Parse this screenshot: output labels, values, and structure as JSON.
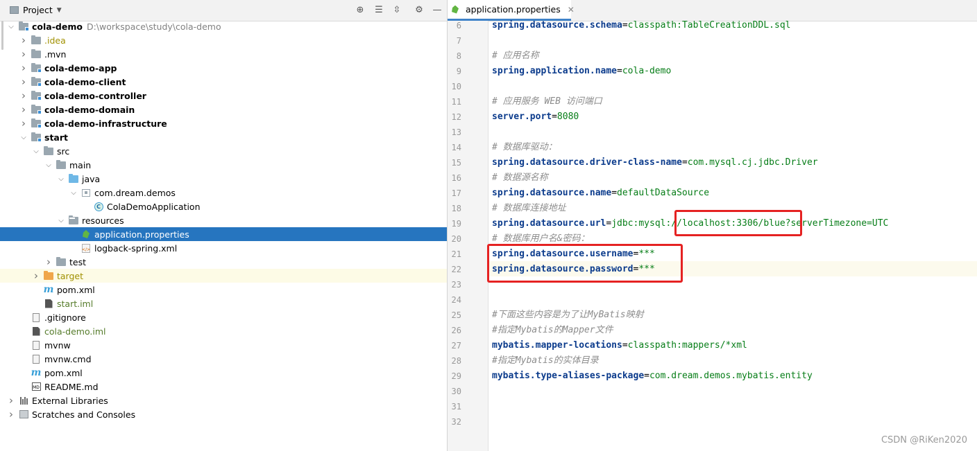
{
  "project_panel": {
    "title": "Project",
    "toolbar": [
      "target-icon",
      "collapse-all-icon",
      "expand-icon",
      "gear-icon",
      "minimize-icon"
    ],
    "tree": [
      {
        "label": "cola-demo",
        "extra": "D:\\workspace\\study\\cola-demo",
        "depth": 0,
        "arrow": "down",
        "icon": "module-folder",
        "style": "bold"
      },
      {
        "label": ".idea",
        "depth": 1,
        "arrow": "right",
        "icon": "folder",
        "style": "olive"
      },
      {
        "label": ".mvn",
        "depth": 1,
        "arrow": "right",
        "icon": "folder",
        "style": ""
      },
      {
        "label": "cola-demo-app",
        "depth": 1,
        "arrow": "right",
        "icon": "module-folder",
        "style": "bold"
      },
      {
        "label": "cola-demo-client",
        "depth": 1,
        "arrow": "right",
        "icon": "module-folder",
        "style": "bold"
      },
      {
        "label": "cola-demo-controller",
        "depth": 1,
        "arrow": "right",
        "icon": "module-folder",
        "style": "bold"
      },
      {
        "label": "cola-demo-domain",
        "depth": 1,
        "arrow": "right",
        "icon": "module-folder",
        "style": "bold"
      },
      {
        "label": "cola-demo-infrastructure",
        "depth": 1,
        "arrow": "right",
        "icon": "module-folder",
        "style": "bold"
      },
      {
        "label": "start",
        "depth": 1,
        "arrow": "down",
        "icon": "module-folder",
        "style": "bold"
      },
      {
        "label": "src",
        "depth": 2,
        "arrow": "down",
        "icon": "folder",
        "style": ""
      },
      {
        "label": "main",
        "depth": 3,
        "arrow": "down",
        "icon": "folder",
        "style": ""
      },
      {
        "label": "java",
        "depth": 4,
        "arrow": "down",
        "icon": "folder-blue",
        "style": ""
      },
      {
        "label": "com.dream.demos",
        "depth": 5,
        "arrow": "down",
        "icon": "package",
        "style": ""
      },
      {
        "label": "ColaDemoApplication",
        "depth": 6,
        "arrow": "none",
        "icon": "class",
        "style": ""
      },
      {
        "label": "resources",
        "depth": 4,
        "arrow": "down",
        "icon": "folder-res",
        "style": ""
      },
      {
        "label": "application.properties",
        "depth": 5,
        "arrow": "none",
        "icon": "spring-leaf",
        "style": "selected"
      },
      {
        "label": "logback-spring.xml",
        "depth": 5,
        "arrow": "none",
        "icon": "xml",
        "style": ""
      },
      {
        "label": "test",
        "depth": 3,
        "arrow": "right",
        "icon": "folder",
        "style": ""
      },
      {
        "label": "target",
        "depth": 2,
        "arrow": "right",
        "icon": "folder-orange",
        "style": "olive-hl"
      },
      {
        "label": "pom.xml",
        "depth": 2,
        "arrow": "none",
        "icon": "maven",
        "style": ""
      },
      {
        "label": "start.iml",
        "depth": 2,
        "arrow": "none",
        "icon": "iml",
        "style": "greentx"
      },
      {
        "label": ".gitignore",
        "depth": 1,
        "arrow": "none",
        "icon": "file",
        "style": ""
      },
      {
        "label": "cola-demo.iml",
        "depth": 1,
        "arrow": "none",
        "icon": "iml",
        "style": "greentx"
      },
      {
        "label": "mvnw",
        "depth": 1,
        "arrow": "none",
        "icon": "file",
        "style": ""
      },
      {
        "label": "mvnw.cmd",
        "depth": 1,
        "arrow": "none",
        "icon": "file",
        "style": ""
      },
      {
        "label": "pom.xml",
        "depth": 1,
        "arrow": "none",
        "icon": "maven",
        "style": ""
      },
      {
        "label": "README.md",
        "depth": 1,
        "arrow": "none",
        "icon": "markdown",
        "style": ""
      },
      {
        "label": "External Libraries",
        "depth": 0,
        "arrow": "right",
        "icon": "libraries",
        "style": ""
      },
      {
        "label": "Scratches and Consoles",
        "depth": 0,
        "arrow": "right",
        "icon": "scratches",
        "style": ""
      }
    ]
  },
  "editor": {
    "tab_label": "application.properties",
    "lines": [
      {
        "n": "6",
        "k": "spring.datasource.schema",
        "v": "classpath:TableCreationDDL.sql"
      },
      {
        "n": "7"
      },
      {
        "n": "8",
        "c": "# 应用名称"
      },
      {
        "n": "9",
        "k": "spring.application.name",
        "v": "cola-demo"
      },
      {
        "n": "10"
      },
      {
        "n": "11",
        "c": "# 应用服务 WEB 访问端口"
      },
      {
        "n": "12",
        "k": "server.port",
        "v": "8080"
      },
      {
        "n": "13"
      },
      {
        "n": "14",
        "c": "# 数据库驱动："
      },
      {
        "n": "15",
        "k": "spring.datasource.driver-class-name",
        "v": "com.mysql.cj.jdbc.Driver"
      },
      {
        "n": "16",
        "c": "# 数据源名称"
      },
      {
        "n": "17",
        "k": "spring.datasource.name",
        "v": "defaultDataSource"
      },
      {
        "n": "18",
        "c": "# 数据库连接地址"
      },
      {
        "n": "19",
        "k": "spring.datasource.url",
        "v": "jdbc:mysql://localhost:3306/blue?serverTimezone=UTC"
      },
      {
        "n": "20",
        "c": "# 数据库用户名&密码："
      },
      {
        "n": "21",
        "k": "spring.datasource.username",
        "v": "***"
      },
      {
        "n": "22",
        "k": "spring.datasource.password",
        "v": "***"
      },
      {
        "n": "23"
      },
      {
        "n": "24"
      },
      {
        "n": "25",
        "c": "#下面这些内容是为了让MyBatis映射"
      },
      {
        "n": "26",
        "c": "#指定Mybatis的Mapper文件"
      },
      {
        "n": "27",
        "k": "mybatis.mapper-locations",
        "v": "classpath:mappers/*xml"
      },
      {
        "n": "28",
        "c": "#指定Mybatis的实体目录"
      },
      {
        "n": "29",
        "k": "mybatis.type-aliases-package",
        "v": "com.dream.demos.mybatis.entity"
      },
      {
        "n": "30"
      },
      {
        "n": "31"
      },
      {
        "n": "32"
      }
    ]
  },
  "watermark": "CSDN @RiKen2020"
}
